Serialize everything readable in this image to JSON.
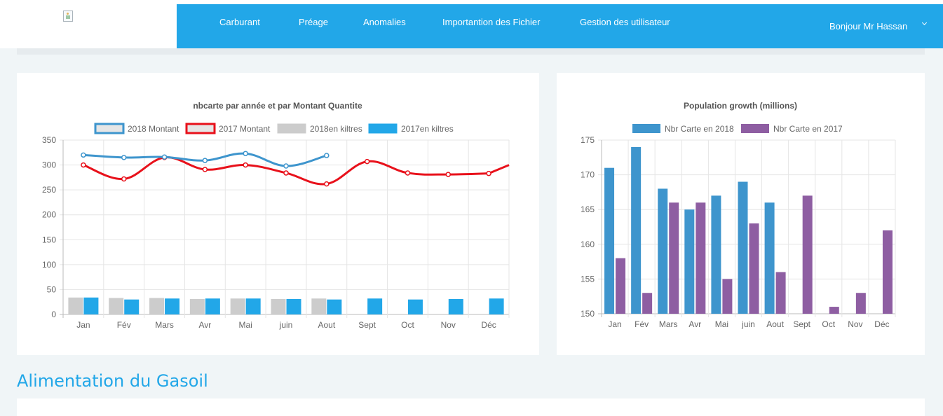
{
  "nav": {
    "items": [
      "Carburant",
      "Préage",
      "Anomalies",
      "Importantion des Fichier",
      "Gestion des utilisateur"
    ],
    "user_label": "Bonjour Mr Hassan"
  },
  "section_title": "Alimentation du Gasoil",
  "colors": {
    "navbar": "#22a7e8",
    "line_2018": "#3e95cd",
    "line_2017": "#e8111b",
    "bar_2018_kl": "#cccccc",
    "bar_2017_kl": "#22a7e8",
    "bar_2018_card": "#3e95cd",
    "bar_2017_card": "#8e5ea2"
  },
  "chart_data": [
    {
      "type": "line",
      "title": "nbcarte par année et par Montant Quantite",
      "categories": [
        "Jan",
        "Fév",
        "Mars",
        "Avr",
        "Mai",
        "juin",
        "Aout",
        "Sept",
        "Oct",
        "Nov",
        "Déc"
      ],
      "ylim": [
        0,
        350
      ],
      "yticks": [
        0,
        50,
        100,
        150,
        200,
        250,
        300,
        350
      ],
      "grid": true,
      "legend_position": "top",
      "series": [
        {
          "name": "2018 Montant",
          "kind": "line",
          "values": [
            320,
            315,
            316,
            309,
            323,
            298,
            319
          ]
        },
        {
          "name": "2017 Montant",
          "kind": "line",
          "values": [
            300,
            272,
            315,
            291,
            300,
            284,
            262,
            307,
            284,
            281,
            283
          ]
        },
        {
          "name": "2018en kiltres",
          "kind": "bar",
          "values": [
            34,
            33,
            33,
            31,
            32,
            31,
            32
          ]
        },
        {
          "name": "2017en kiltres",
          "kind": "bar",
          "values": [
            34,
            30,
            32,
            32,
            32,
            31,
            30,
            32,
            30,
            31,
            32
          ]
        }
      ]
    },
    {
      "type": "bar",
      "title": "Population growth (millions)",
      "categories": [
        "Jan",
        "Fév",
        "Mars",
        "Avr",
        "Mai",
        "juin",
        "Aout",
        "Sept",
        "Oct",
        "Nov",
        "Déc"
      ],
      "ylim": [
        150,
        175
      ],
      "yticks": [
        150,
        155,
        160,
        165,
        170,
        175
      ],
      "grid": true,
      "legend_position": "top",
      "series": [
        {
          "name": "Nbr Carte en 2018",
          "values": [
            171,
            174,
            168,
            165,
            167,
            169,
            166,
            null,
            null,
            null,
            null
          ]
        },
        {
          "name": "Nbr Carte en 2017",
          "values": [
            158,
            153,
            166,
            166,
            155,
            163,
            156,
            167,
            151,
            153,
            162
          ]
        }
      ]
    }
  ]
}
